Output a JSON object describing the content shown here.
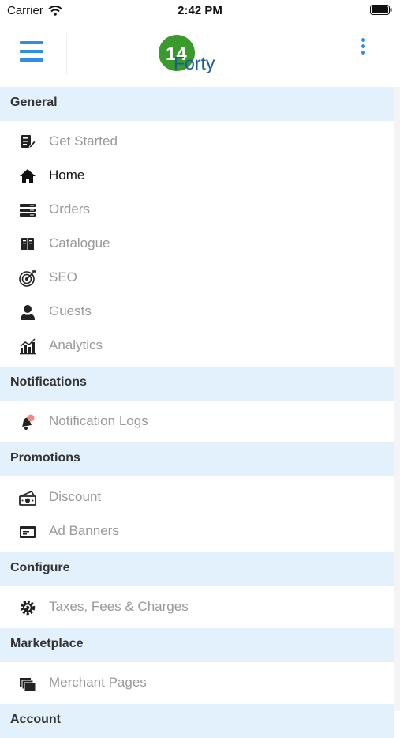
{
  "status_bar": {
    "carrier": "Carrier",
    "time": "2:42 PM"
  },
  "header": {
    "logo_top": "14",
    "logo_bottom": "Forty",
    "menu_icon": "hamburger-menu-icon",
    "more_icon": "vertical-dots-icon",
    "accent_color": "#2f8de4"
  },
  "sections": [
    {
      "title": "General",
      "items": [
        {
          "label": "Get Started",
          "icon": "checklist-pen-icon",
          "active": false
        },
        {
          "label": "Home",
          "icon": "home-icon",
          "active": true
        },
        {
          "label": "Orders",
          "icon": "stacked-list-icon",
          "active": false
        },
        {
          "label": "Catalogue",
          "icon": "book-icon",
          "active": false
        },
        {
          "label": "SEO",
          "icon": "target-icon",
          "active": false
        },
        {
          "label": "Guests",
          "icon": "user-icon",
          "active": false
        },
        {
          "label": "Analytics",
          "icon": "bar-chart-icon",
          "active": false
        }
      ]
    },
    {
      "title": "Notifications",
      "items": [
        {
          "label": "Notification Logs",
          "icon": "bell-icon",
          "active": false
        }
      ]
    },
    {
      "title": "Promotions",
      "items": [
        {
          "label": "Discount",
          "icon": "cash-icon",
          "active": false
        },
        {
          "label": "Ad Banners",
          "icon": "banner-icon",
          "active": false
        }
      ]
    },
    {
      "title": "Configure",
      "items": [
        {
          "label": "Taxes, Fees & Charges",
          "icon": "gear-refresh-icon",
          "active": false
        }
      ]
    },
    {
      "title": "Marketplace",
      "items": [
        {
          "label": "Merchant Pages",
          "icon": "stacked-pages-icon",
          "active": false
        }
      ]
    },
    {
      "title": "Account",
      "items": []
    }
  ]
}
